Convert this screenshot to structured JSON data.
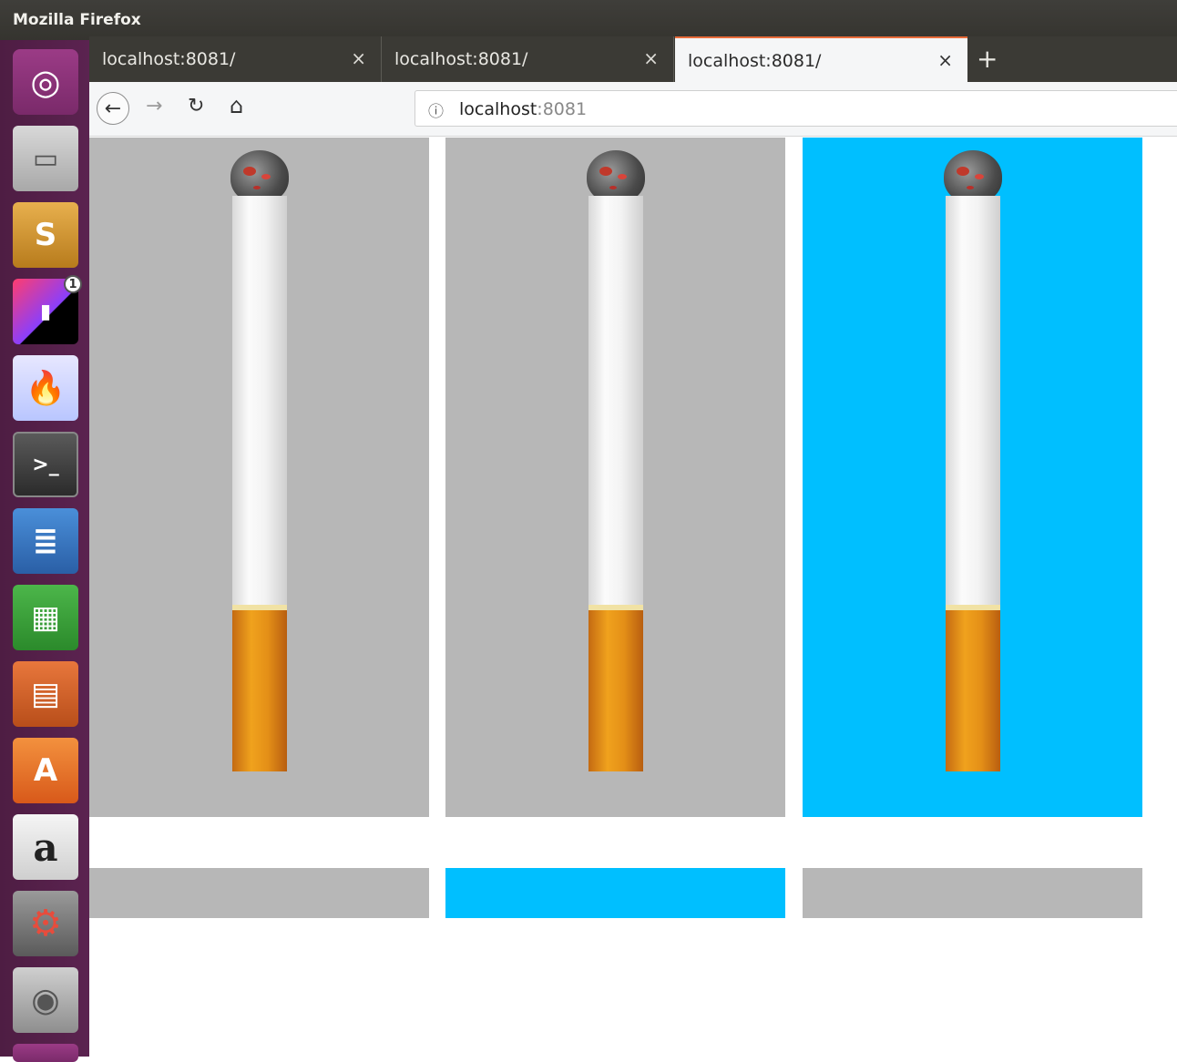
{
  "window": {
    "title": "Mozilla Firefox"
  },
  "tabs": [
    {
      "label": "localhost:8081/",
      "close": "×"
    },
    {
      "label": "localhost:8081/",
      "close": "×"
    },
    {
      "label": "localhost:8081/",
      "close": "×"
    }
  ],
  "active_tab_index": 2,
  "new_tab_symbol": "+",
  "nav": {
    "back": "←",
    "forward": "→",
    "reload": "↻",
    "home": "⌂"
  },
  "url": {
    "info_icon": "ⓘ",
    "host": "localhost",
    "port": ":8081"
  },
  "launcher": [
    {
      "name": "ubuntu-dash-icon",
      "glyph": "◎"
    },
    {
      "name": "files-icon",
      "glyph": "▭"
    },
    {
      "name": "sublime-text-icon",
      "glyph": "S"
    },
    {
      "name": "jetbrains-toolbox-icon",
      "glyph": "▮"
    },
    {
      "name": "firefox-icon",
      "glyph": "🔥"
    },
    {
      "name": "terminal-icon",
      "glyph": ">_"
    },
    {
      "name": "libreoffice-writer-icon",
      "glyph": "≣"
    },
    {
      "name": "libreoffice-calc-icon",
      "glyph": "▦"
    },
    {
      "name": "libreoffice-impress-icon",
      "glyph": "▤"
    },
    {
      "name": "software-center-icon",
      "glyph": "A"
    },
    {
      "name": "amazon-icon",
      "glyph": "a"
    },
    {
      "name": "system-settings-icon",
      "glyph": "⚙"
    },
    {
      "name": "disk-icon",
      "glyph": "◉"
    }
  ],
  "badge": {
    "count": "1"
  },
  "colors": {
    "panel_gray": "#b7b7b7",
    "panel_selected": "#00bfff",
    "launcher_bg": "#5b2350"
  },
  "panels": [
    {
      "selected": false
    },
    {
      "selected": false
    },
    {
      "selected": true
    }
  ],
  "bars": [
    {
      "selected": false
    },
    {
      "selected": true
    },
    {
      "selected": false
    }
  ]
}
